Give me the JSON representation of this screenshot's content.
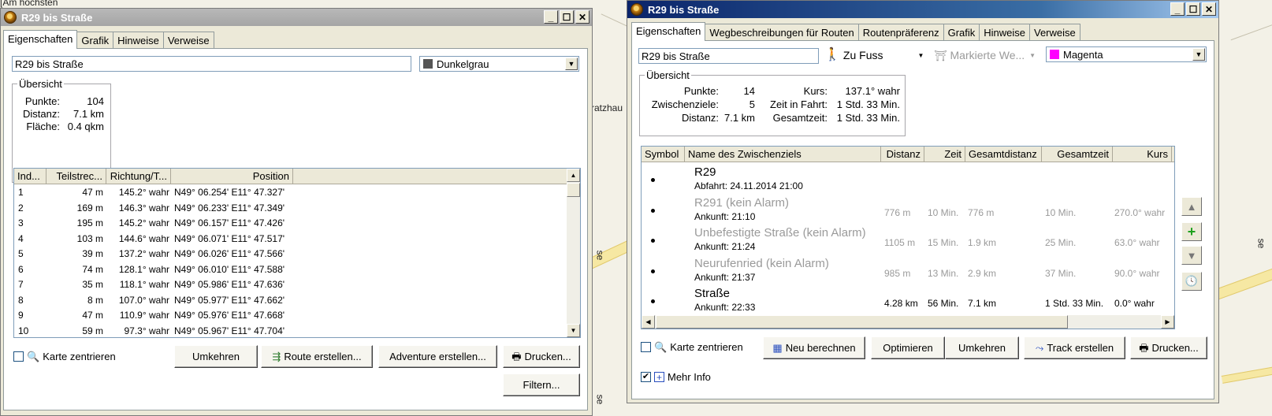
{
  "map": {
    "labels": [
      "[Am höchsten",
      "ratzhau",
      "se",
      "se",
      "se"
    ]
  },
  "colors": {
    "magenta": "#ff00ff",
    "dunkelgrau": "#555555"
  },
  "left_window": {
    "title": "R29 bis Straße",
    "tabs": [
      "Eigenschaften",
      "Grafik",
      "Hinweise",
      "Verweise"
    ],
    "name_value": "R29 bis Straße",
    "color_value": "Dunkelgrau",
    "overview": {
      "title": "Übersicht",
      "points_label": "Punkte:",
      "points_value": "104",
      "distance_label": "Distanz:",
      "distance_value": "7.1 km",
      "area_label": "Fläche:",
      "area_value": "0.4 qkm"
    },
    "columns": [
      "Ind...",
      "Teilstrec...",
      "Richtung/T...",
      "Position"
    ],
    "rows": [
      [
        "1",
        "47 m",
        "145.2° wahr",
        "N49° 06.254' E11° 47.327'"
      ],
      [
        "2",
        "169 m",
        "146.3° wahr",
        "N49° 06.233' E11° 47.349'"
      ],
      [
        "3",
        "195 m",
        "145.2° wahr",
        "N49° 06.157' E11° 47.426'"
      ],
      [
        "4",
        "103 m",
        "144.6° wahr",
        "N49° 06.071' E11° 47.517'"
      ],
      [
        "5",
        "39 m",
        "137.2° wahr",
        "N49° 06.026' E11° 47.566'"
      ],
      [
        "6",
        "74 m",
        "128.1° wahr",
        "N49° 06.010' E11° 47.588'"
      ],
      [
        "7",
        "35 m",
        "118.1° wahr",
        "N49° 05.986' E11° 47.636'"
      ],
      [
        "8",
        "8 m",
        "107.0° wahr",
        "N49° 05.977' E11° 47.662'"
      ],
      [
        "9",
        "47 m",
        "110.9° wahr",
        "N49° 05.976' E11° 47.668'"
      ],
      [
        "10",
        "59 m",
        "97.3° wahr",
        "N49° 05.967' E11° 47.704'"
      ]
    ],
    "center_map": "Karte zentrieren",
    "buttons": {
      "reverse": "Umkehren",
      "create_route": "Route erstellen...",
      "create_adventure": "Adventure erstellen...",
      "print": "Drucken...",
      "filter": "Filtern..."
    }
  },
  "right_window": {
    "title": "R29 bis Straße",
    "tabs": [
      "Eigenschaften",
      "Wegbeschreibungen für Routen",
      "Routenpräferenz",
      "Grafik",
      "Hinweise",
      "Verweise"
    ],
    "name_value": "R29 bis Straße",
    "mode_value": "Zu Fuss",
    "marked_value": "Markierte We...",
    "color_value": "Magenta",
    "overview": {
      "title": "Übersicht",
      "points_label": "Punkte:",
      "points_value": "14",
      "waypoints_label": "Zwischenziele:",
      "waypoints_value": "5",
      "distance_label": "Distanz:",
      "distance_value": "7.1 km",
      "course_label": "Kurs:",
      "course_value": "137.1° wahr",
      "travel_label": "Zeit in Fahrt:",
      "travel_value": "1 Std. 33 Min.",
      "total_label": "Gesamtzeit:",
      "total_value": "1 Std. 33 Min."
    },
    "columns": [
      "Symbol",
      "Name des Zwischenziels",
      "Distanz",
      "Zeit",
      "Gesamtdistanz",
      "Gesamtzeit",
      "Kurs"
    ],
    "waypoints": [
      {
        "name": "R29",
        "sub": "Abfahrt: 24.11.2014 21:00",
        "dist": "",
        "time": "",
        "total_dist": "",
        "total_time": "",
        "course": ""
      },
      {
        "name": "R291 (kein Alarm)",
        "sub": "Ankunft: 21:10",
        "dist": "776 m",
        "time": "10 Min.",
        "total_dist": "776 m",
        "total_time": "10 Min.",
        "course": "270.0° wahr"
      },
      {
        "name": "Unbefestigte Straße (kein Alarm)",
        "sub": "Ankunft: 21:24",
        "dist": "1105 m",
        "time": "15 Min.",
        "total_dist": "1.9 km",
        "total_time": "25 Min.",
        "course": "63.0° wahr"
      },
      {
        "name": "Neurufenried (kein Alarm)",
        "sub": "Ankunft: 21:37",
        "dist": "985 m",
        "time": "13 Min.",
        "total_dist": "2.9 km",
        "total_time": "37 Min.",
        "course": "90.0° wahr"
      },
      {
        "name": "Straße",
        "sub": "Ankunft: 22:33",
        "dist": "4.28 km",
        "time": "56 Min.",
        "total_dist": "7.1 km",
        "total_time": "1 Std. 33 Min.",
        "course": "0.0° wahr"
      }
    ],
    "center_map": "Karte zentrieren",
    "more_info": "Mehr Info",
    "buttons": {
      "recalculate": "Neu berechnen",
      "optimize": "Optimieren",
      "reverse": "Umkehren",
      "create_track": "Track erstellen",
      "print": "Drucken..."
    }
  }
}
